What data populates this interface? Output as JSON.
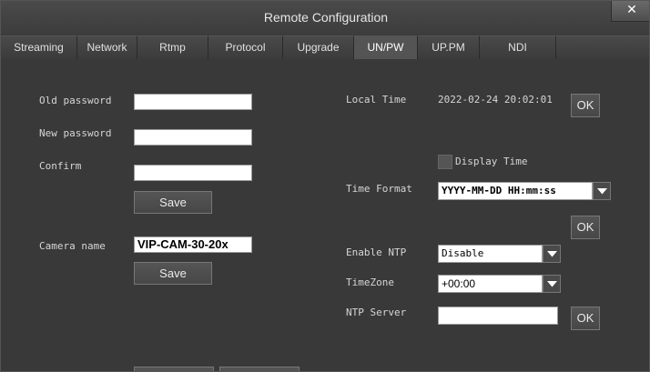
{
  "window": {
    "title": "Remote Configuration",
    "close_glyph": "✕"
  },
  "tabs": [
    {
      "label": "Streaming",
      "active": false
    },
    {
      "label": "Network",
      "active": false
    },
    {
      "label": "Rtmp",
      "active": false
    },
    {
      "label": "Protocol",
      "active": false
    },
    {
      "label": "Upgrade",
      "active": false
    },
    {
      "label": "UN/PW",
      "active": true
    },
    {
      "label": "UP.PM",
      "active": false
    },
    {
      "label": "NDI",
      "active": false
    }
  ],
  "password": {
    "old_label": "Old password",
    "new_label": "New password",
    "confirm_label": "Confirm",
    "old_value": "",
    "new_value": "",
    "confirm_value": "",
    "save_label": "Save"
  },
  "camera": {
    "label": "Camera name",
    "value": "VIP-CAM-30-20x",
    "save_label": "Save"
  },
  "time": {
    "local_label": "Local Time",
    "local_value": "2022-02-24 20:02:01",
    "ok_label": "OK",
    "display_time_label": "Display Time",
    "display_time_checked": false,
    "format_label": "Time Format",
    "format_value": "YYYY-MM-DD HH:mm:ss",
    "format_ok_label": "OK",
    "ntp_label": "Enable NTP",
    "ntp_value": "Disable",
    "tz_label": "TimeZone",
    "tz_value": "+00:00",
    "ntp_server_label": "NTP Server",
    "ntp_server_value": "",
    "ntp_ok_label": "OK"
  },
  "icons": {
    "close": "close-icon",
    "dropdown": "chevron-down-icon"
  }
}
